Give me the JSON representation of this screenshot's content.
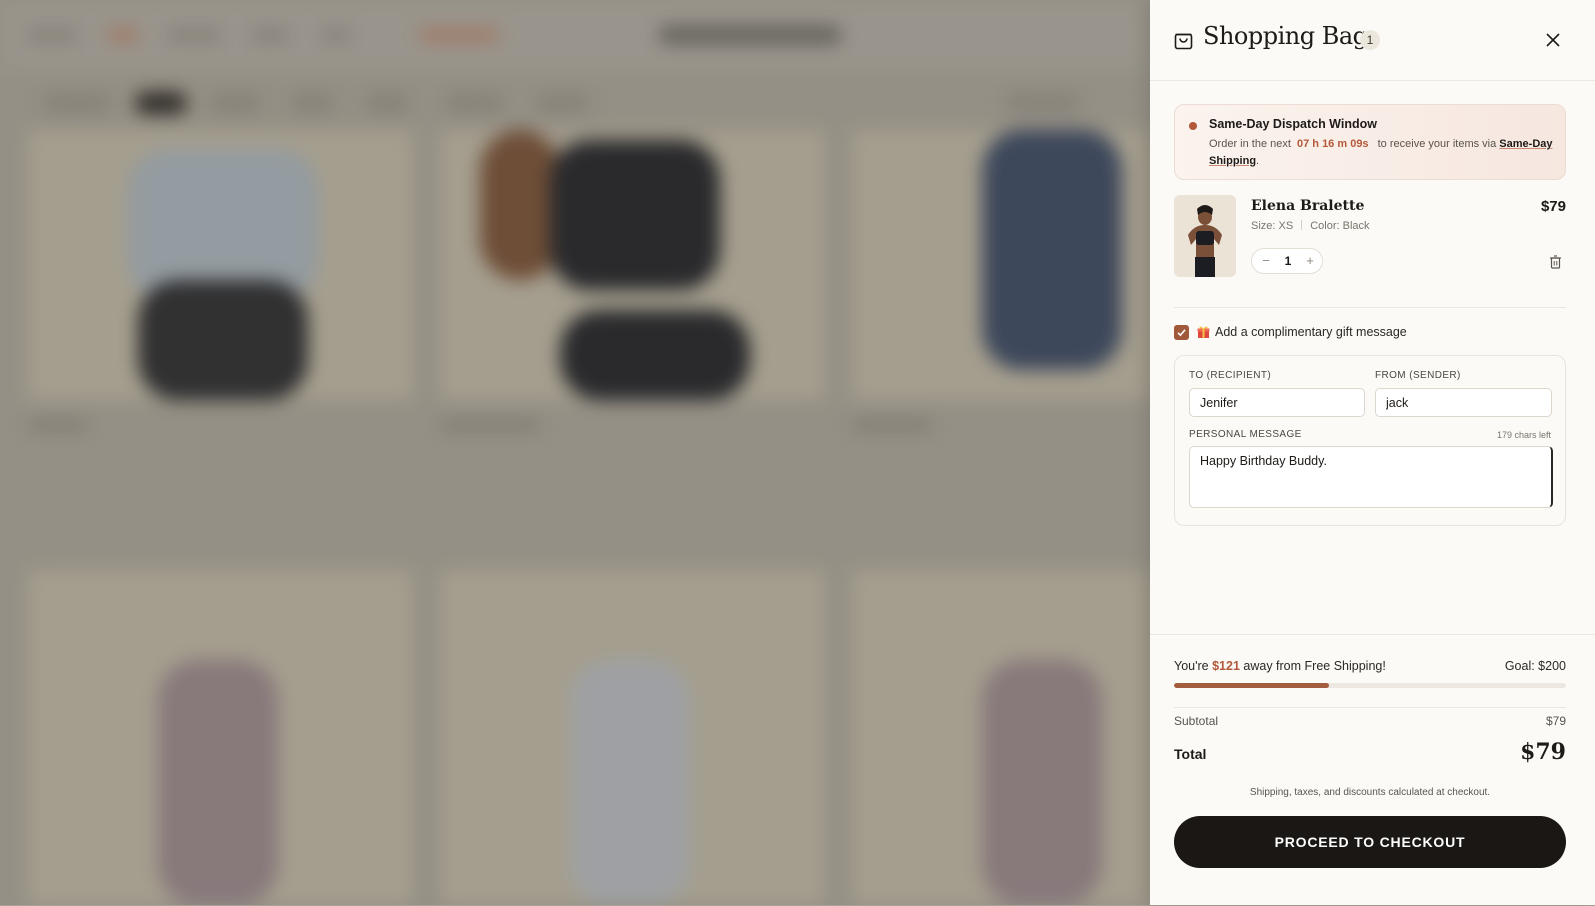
{
  "drawer": {
    "title": "Shopping Bag",
    "count": "1",
    "icons": {
      "bag": "shopping-bag-icon",
      "close": "close-icon",
      "trash": "trash-icon",
      "gift": "gift-icon",
      "check": "check-icon"
    }
  },
  "dispatch": {
    "title": "Same-Day Dispatch Window",
    "text_before": "Order in the next",
    "timer": "07 h 16 m 09s",
    "text_middle": "to receive your items via",
    "link": "Same-Day Shipping",
    "text_after": "."
  },
  "item": {
    "name": "Elena Bralette",
    "price": "$79",
    "size_label": "Size:",
    "size": "XS",
    "color_label": "Color:",
    "color": "Black",
    "quantity": "1",
    "minus": "−",
    "plus": "+"
  },
  "gift": {
    "checked": true,
    "label": "Add a complimentary gift message",
    "to_label": "To (Recipient)",
    "to_value": "Jenifer",
    "from_label": "From (Sender)",
    "from_value": "jack",
    "message_label": "Personal Message",
    "chars_left": "179 chars left",
    "message_value": "Happy Birthday Buddy."
  },
  "summary": {
    "ship_prefix": "You're",
    "ship_amount": "$121",
    "ship_suffix": "away from Free Shipping!",
    "goal": "Goal: $200",
    "progress_fraction": 0.395,
    "subtotal_label": "Subtotal",
    "subtotal": "$79",
    "total_label": "Total",
    "total": "$79",
    "note": "Shipping, taxes, and discounts calculated at checkout.",
    "checkout_label": "PROCEED TO CHECKOUT"
  },
  "colors": {
    "accent": "#b3593a",
    "button": "#1a1714",
    "progress": "#a45c3e"
  }
}
